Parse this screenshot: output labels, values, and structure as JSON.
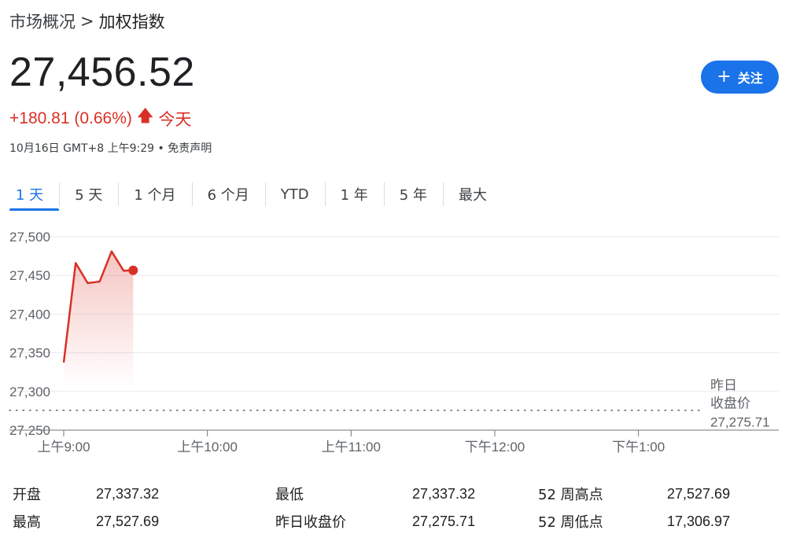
{
  "breadcrumb": {
    "parent": "市场概况",
    "separator": ">",
    "current": "加权指数"
  },
  "quote": {
    "price": "27,456.52",
    "change": "+180.81 (0.66%)",
    "period": "今天",
    "timestamp": "10月16日 GMT+8 上午9:29",
    "dot": "•",
    "disclaimer": "免责声明",
    "positive_color": "#d93025"
  },
  "follow": {
    "label": "关注",
    "color": "#1a73e8"
  },
  "tabs": [
    {
      "label": "1 天",
      "active": true
    },
    {
      "label": "5 天"
    },
    {
      "label": "1 个月"
    },
    {
      "label": "6 个月"
    },
    {
      "label": "YTD"
    },
    {
      "label": "1 年"
    },
    {
      "label": "5 年"
    },
    {
      "label": "最大"
    }
  ],
  "chart_data": {
    "type": "line",
    "x_unit": "time",
    "x": [
      "09:00",
      "09:05",
      "09:10",
      "09:15",
      "09:20",
      "09:25",
      "09:29"
    ],
    "series": [
      {
        "values": [
          27337.32,
          27466,
          27440,
          27442,
          27481,
          27456,
          27456.52
        ]
      }
    ],
    "ylim": [
      27250,
      27500
    ],
    "yticks": [
      "27,500",
      "27,450",
      "27,400",
      "27,350",
      "27,300",
      "27,250"
    ],
    "xticks": [
      "上午9:00",
      "上午10:00",
      "上午11:00",
      "下午12:00",
      "下午1:00"
    ],
    "xlim": [
      "09:00",
      "13:30"
    ],
    "previous_close": {
      "label_line1": "昨日",
      "label_line2": "收盘价",
      "value": 27275.71,
      "value_text": "27,275.71"
    },
    "line_color": "#d93025",
    "grid": true
  },
  "stats": {
    "open": {
      "label": "开盘",
      "value": "27,337.32"
    },
    "high": {
      "label": "最高",
      "value": "27,527.69"
    },
    "low": {
      "label": "最低",
      "value": "27,337.32"
    },
    "prev_close": {
      "label": "昨日收盘价",
      "value": "27,275.71"
    },
    "wk52_high": {
      "label": "52 周高点",
      "value": "27,527.69"
    },
    "wk52_low": {
      "label": "52 周低点",
      "value": "17,306.97"
    }
  }
}
